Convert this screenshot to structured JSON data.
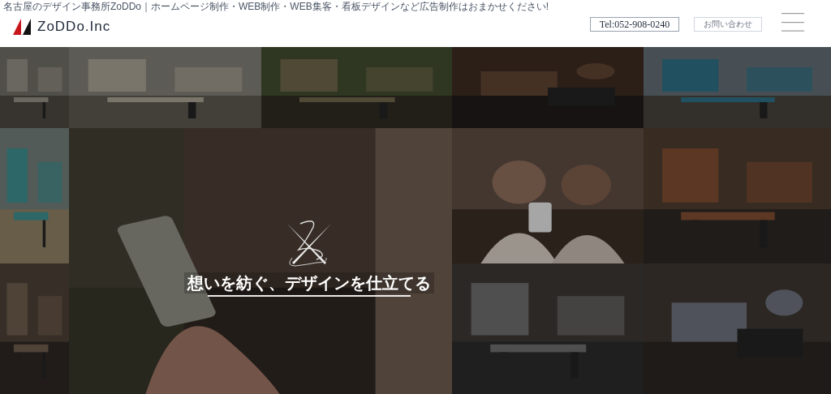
{
  "header": {
    "tagline": "名古屋のデザイン事務所ZoDDo｜ホームページ制作・WEB制作・WEB集客・看板デザインなど広告制作はおまかせください!",
    "logo_text": "ZoDDo.Inc",
    "phone_button": "Tel:052-908-0240",
    "contact_button": "お問い合わせ"
  },
  "hero": {
    "caption": "想いを紡ぐ、デザインを仕立てる"
  }
}
